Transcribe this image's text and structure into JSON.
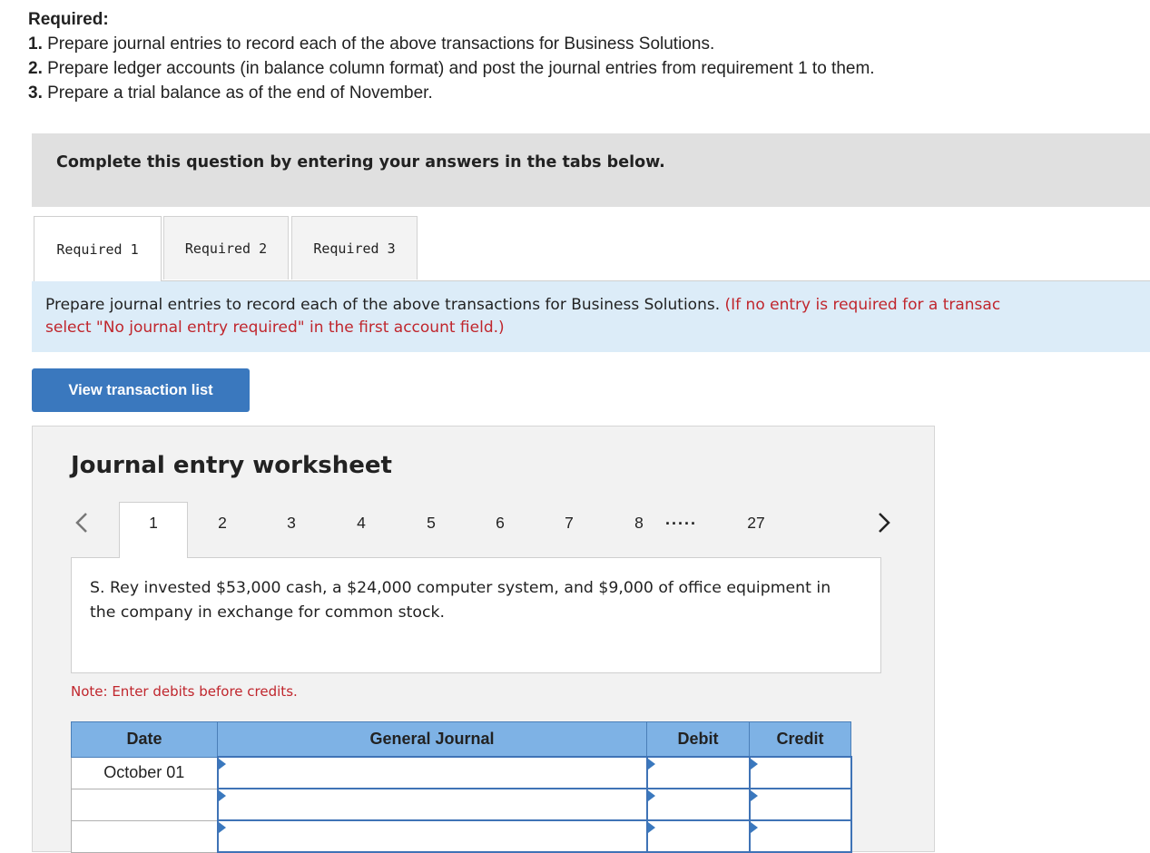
{
  "required": {
    "heading": "Required:",
    "items": [
      {
        "num": "1.",
        "text": " Prepare journal entries to record each of the above transactions for Business Solutions."
      },
      {
        "num": "2.",
        "text": " Prepare ledger accounts (in balance column format) and post the journal entries from requirement 1 to them."
      },
      {
        "num": "3.",
        "text": " Prepare a trial balance as of the end of November."
      }
    ]
  },
  "banner": "Complete this question by entering your answers in the tabs below.",
  "tabs": [
    {
      "label": "Required 1",
      "active": true
    },
    {
      "label": "Required 2",
      "active": false
    },
    {
      "label": "Required 3",
      "active": false
    }
  ],
  "instruction": {
    "text": "Prepare journal entries to record each of the above transactions for Business Solutions. ",
    "red_line1": "(If no entry is required for a transac",
    "red_line2": "select \"No journal entry required\" in the first account field.)"
  },
  "view_button": "View transaction list",
  "worksheet": {
    "title": "Journal entry worksheet",
    "pages": [
      "1",
      "2",
      "3",
      "4",
      "5",
      "6",
      "7",
      "8"
    ],
    "ellipsis": ".....",
    "last_page": "27",
    "active_page": "1",
    "description": "S. Rey invested $53,000 cash, a $24,000 computer system, and $9,000 of office equipment in the company in exchange for common stock.",
    "note": "Note: Enter debits before credits.",
    "table": {
      "headers": [
        "Date",
        "General Journal",
        "Debit",
        "Credit"
      ],
      "rows": [
        {
          "date": "October 01",
          "account": "",
          "debit": "",
          "credit": ""
        },
        {
          "date": "",
          "account": "",
          "debit": "",
          "credit": ""
        },
        {
          "date": "",
          "account": "",
          "debit": "",
          "credit": ""
        }
      ]
    }
  },
  "colors": {
    "accent": "#3a78be",
    "header_blue": "#7eb2e5",
    "instruction_bg": "#dcecf8",
    "note_red": "#c0262d"
  }
}
